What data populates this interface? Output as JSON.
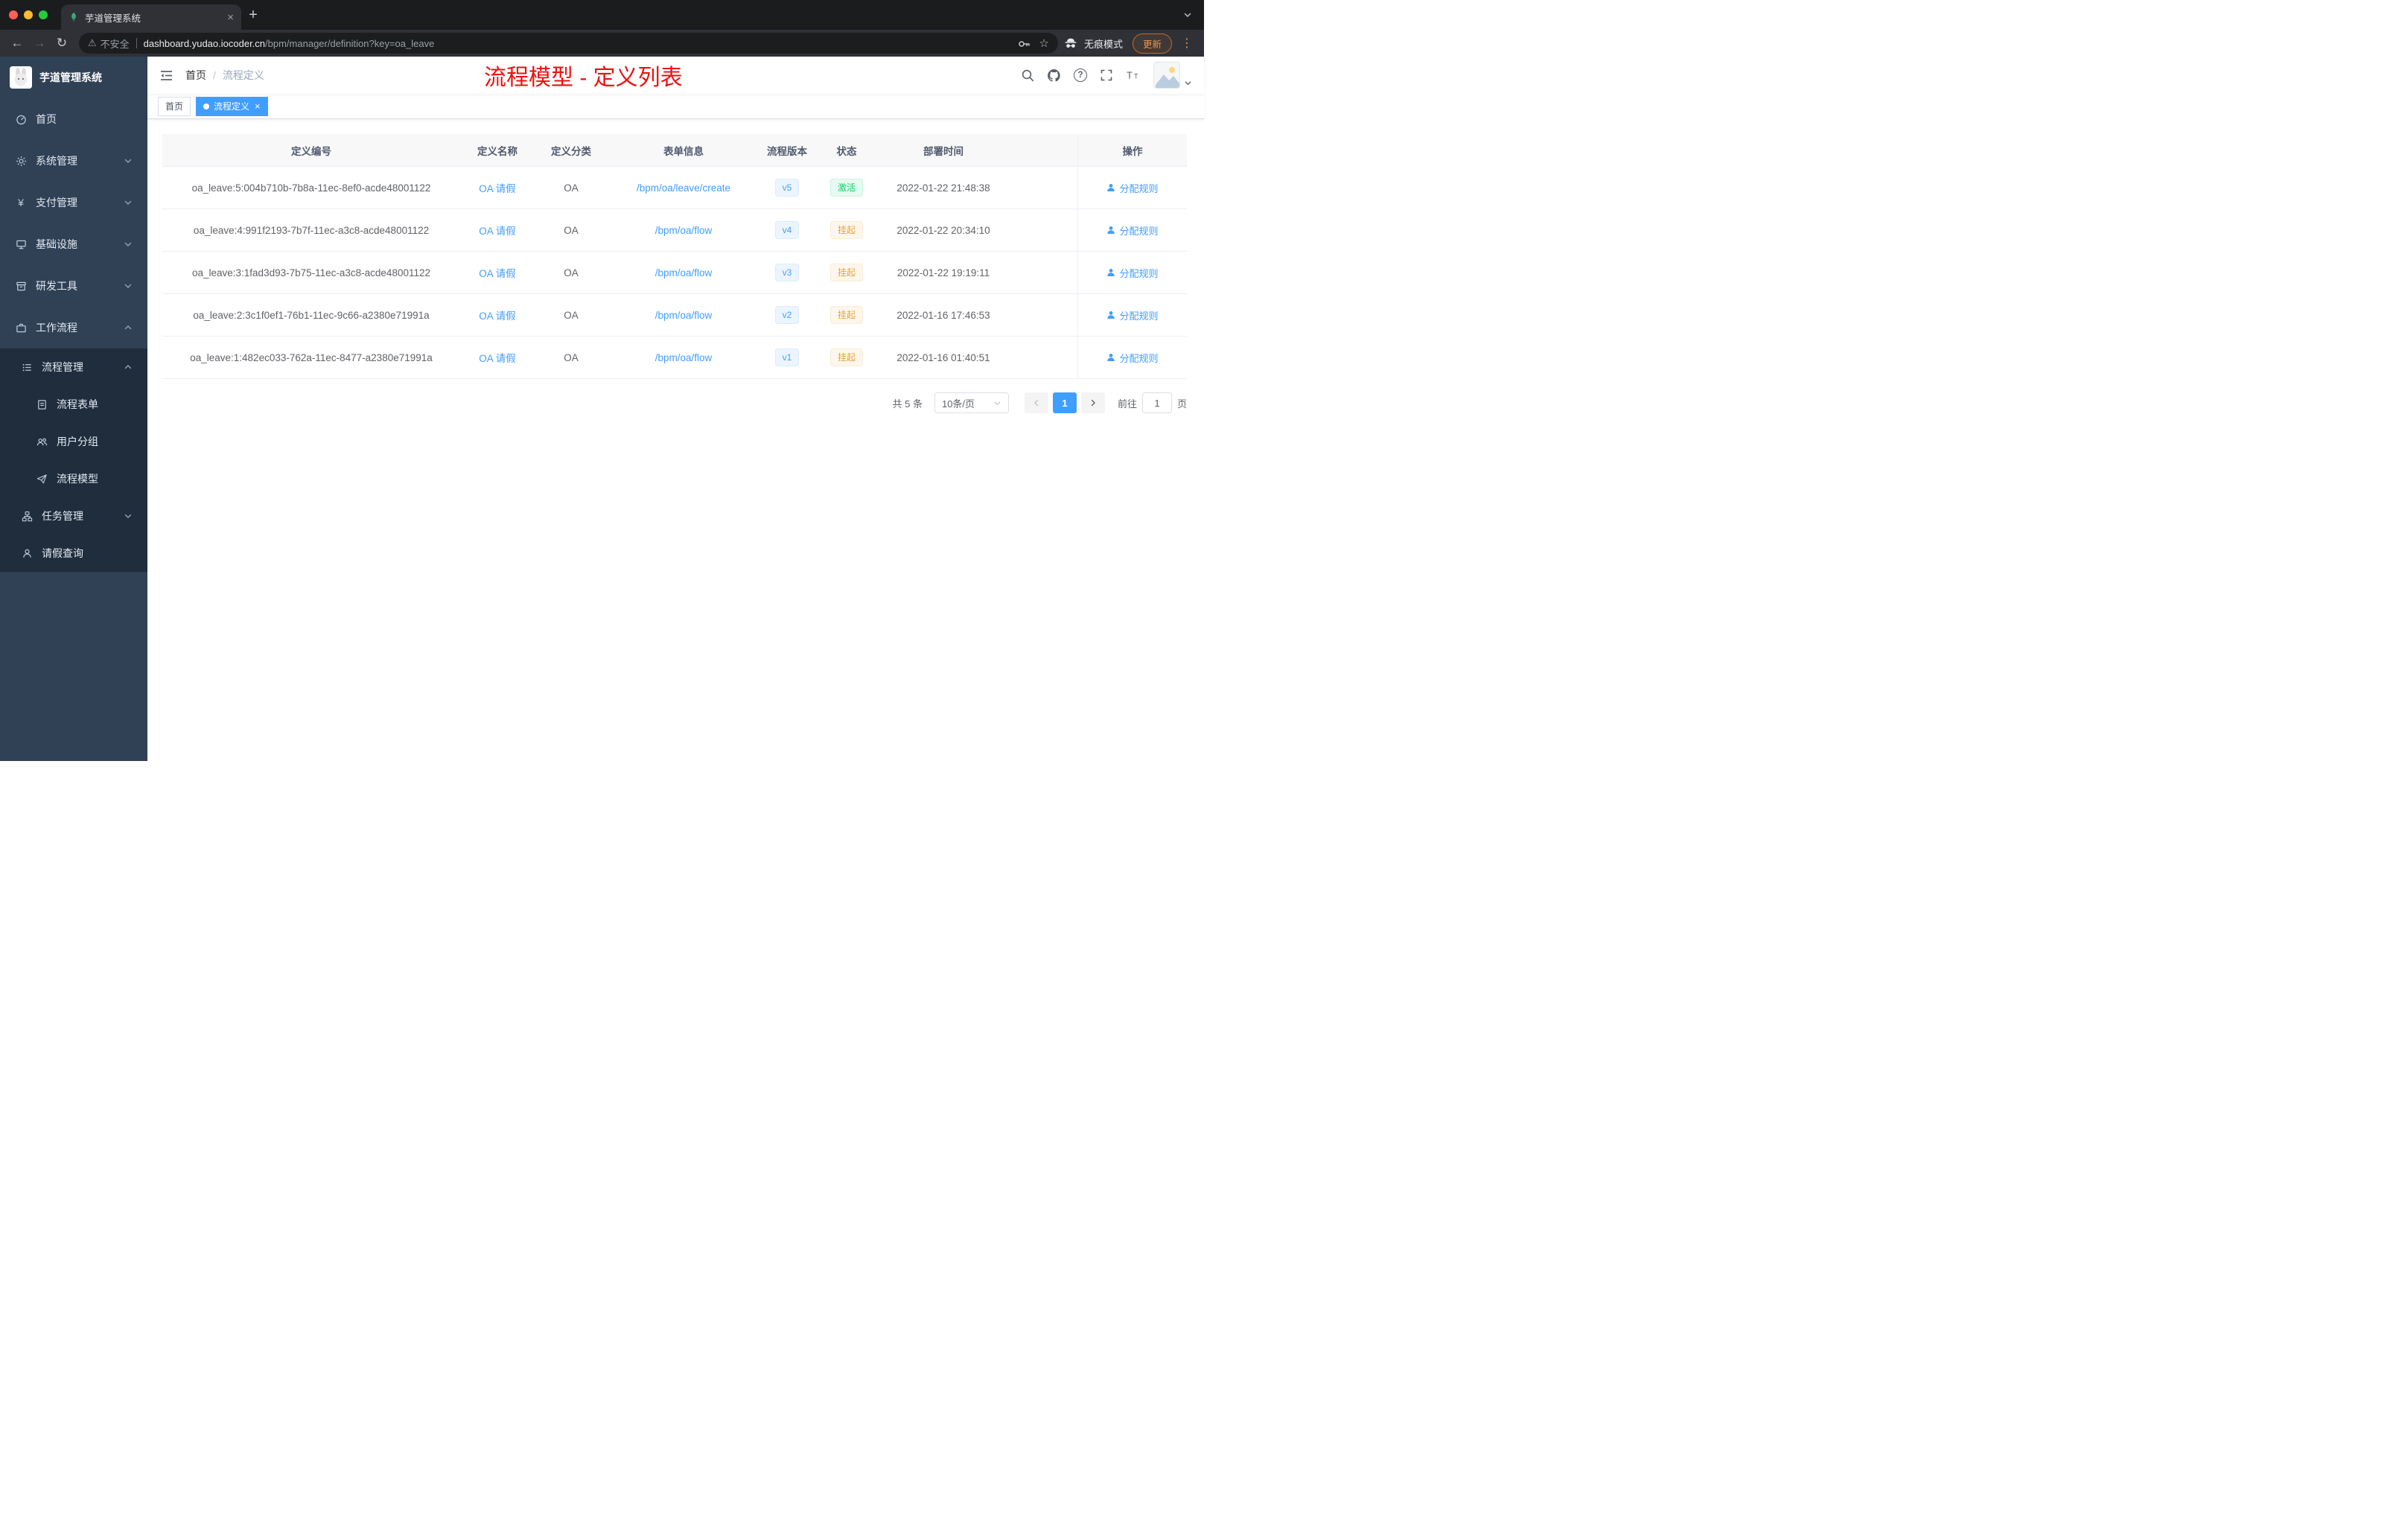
{
  "browser": {
    "tab_title": "芋道管理系统",
    "security_label": "不安全",
    "url_host": "dashboard.yudao.iocoder.cn",
    "url_path": "/bpm/manager/definition?key=oa_leave",
    "incognito_label": "无痕模式",
    "update_label": "更新"
  },
  "sidebar": {
    "logo_title": "芋道管理系统",
    "menu": [
      {
        "label": "首页"
      },
      {
        "label": "系统管理"
      },
      {
        "label": "支付管理"
      },
      {
        "label": "基础设施"
      },
      {
        "label": "研发工具"
      },
      {
        "label": "工作流程"
      }
    ],
    "submenu": [
      {
        "label": "流程管理"
      },
      {
        "label": "流程表单"
      },
      {
        "label": "用户分组"
      },
      {
        "label": "流程模型"
      },
      {
        "label": "任务管理"
      },
      {
        "label": "请假查询"
      }
    ]
  },
  "header": {
    "breadcrumb_home": "首页",
    "breadcrumb_current": "流程定义",
    "annotation": "流程模型 - 定义列表"
  },
  "tags": [
    {
      "label": "首页"
    },
    {
      "label": "流程定义"
    }
  ],
  "table": {
    "columns": [
      "定义编号",
      "定义名称",
      "定义分类",
      "表单信息",
      "流程版本",
      "状态",
      "部署时间",
      "操作"
    ],
    "rows": [
      {
        "id": "oa_leave:5:004b710b-7b8a-11ec-8ef0-acde48001122",
        "name": "OA 请假",
        "category": "OA",
        "form": "/bpm/oa/leave/create",
        "version": "v5",
        "status": "激活",
        "status_type": "success",
        "time": "2022-01-22 21:48:38",
        "action": "分配规则"
      },
      {
        "id": "oa_leave:4:991f2193-7b7f-11ec-a3c8-acde48001122",
        "name": "OA 请假",
        "category": "OA",
        "form": "/bpm/oa/flow",
        "version": "v4",
        "status": "挂起",
        "status_type": "warning",
        "time": "2022-01-22 20:34:10",
        "action": "分配规则"
      },
      {
        "id": "oa_leave:3:1fad3d93-7b75-11ec-a3c8-acde48001122",
        "name": "OA 请假",
        "category": "OA",
        "form": "/bpm/oa/flow",
        "version": "v3",
        "status": "挂起",
        "status_type": "warning",
        "time": "2022-01-22 19:19:11",
        "action": "分配规则"
      },
      {
        "id": "oa_leave:2:3c1f0ef1-76b1-11ec-9c66-a2380e71991a",
        "name": "OA 请假",
        "category": "OA",
        "form": "/bpm/oa/flow",
        "version": "v2",
        "status": "挂起",
        "status_type": "warning",
        "time": "2022-01-16 17:46:53",
        "action": "分配规则"
      },
      {
        "id": "oa_leave:1:482ec033-762a-11ec-8477-a2380e71991a",
        "name": "OA 请假",
        "category": "OA",
        "form": "/bpm/oa/flow",
        "version": "v1",
        "status": "挂起",
        "status_type": "warning",
        "time": "2022-01-16 01:40:51",
        "action": "分配规则"
      }
    ]
  },
  "pagination": {
    "total": "共 5 条",
    "page_size": "10条/页",
    "current_page": "1",
    "goto_label": "前往",
    "goto_value": "1",
    "unit_label": "页"
  },
  "colors": {
    "accent": "#409eff",
    "success": "#13ce66",
    "warning": "#e6a23c",
    "annotation_red": "#ee0f0f",
    "sidebar_bg": "#304156",
    "submenu_bg": "#1f2d3d"
  }
}
